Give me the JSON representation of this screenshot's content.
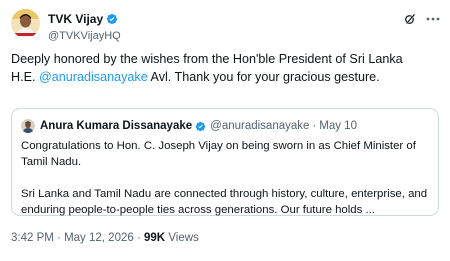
{
  "author": {
    "display_name": "TVK Vijay",
    "handle": "@TVKVijayHQ",
    "avatar_icon": "avatar-portrait",
    "verified_color": "#1d9bf0"
  },
  "tweet": {
    "text_line1": "Deeply honored by the wishes from the Hon'ble President of Sri Lanka",
    "text_line2_prefix": "H.E. ",
    "mention": "@anuradisanayake",
    "text_line2_suffix": " Avl. Thank you for your gracious gesture."
  },
  "quoted": {
    "display_name": "Anura Kumara Dissanayake",
    "handle": "@anuradisanayake",
    "separator": "·",
    "date": "May 10",
    "paragraph1": "Congratulations to Hon. C. Joseph Vijay on being sworn in as Chief Minister of Tamil Nadu.",
    "paragraph2": "Sri Lanka and Tamil Nadu are connected through history, culture, enterprise, and enduring people-to-people ties across generations. Our future holds ..."
  },
  "footer": {
    "time": "3:42 PM",
    "separator": "·",
    "date": "May 12, 2026",
    "views_count": "99K",
    "views_label": "Views"
  },
  "colors": {
    "accent": "#1d9bf0",
    "secondary_text": "#536471",
    "border": "#cfd9de"
  }
}
